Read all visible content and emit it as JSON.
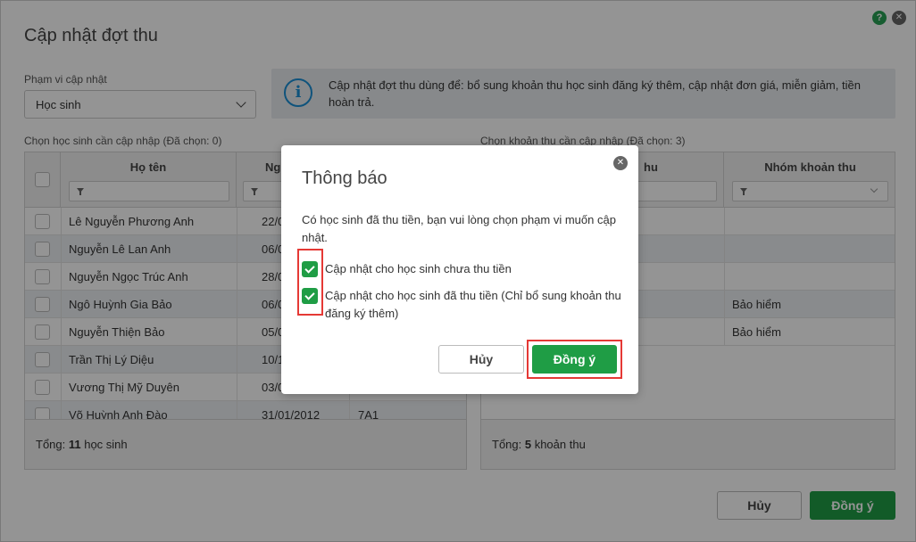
{
  "window": {
    "title": "Cập nhật đợt thu"
  },
  "scope": {
    "label": "Phạm vi cập nhật",
    "value": "Học sinh"
  },
  "info": {
    "text": "Cập nhật đợt thu dùng để: bổ sung khoản thu học sinh đăng ký thêm, cập nhật đơn giá, miễn giảm, tiền hoàn trả."
  },
  "students_grid": {
    "label": "Chọn học sinh cần cập nhập (Đã chọn: 0)",
    "columns": [
      "Họ tên",
      "Ng"
    ],
    "rows": [
      {
        "name": "Lê Nguyễn Phương Anh",
        "date": "22/0",
        "class": ""
      },
      {
        "name": "Nguyễn Lê  Lan Anh",
        "date": "06/0",
        "class": ""
      },
      {
        "name": "Nguyễn Ngọc Trúc Anh",
        "date": "28/0",
        "class": ""
      },
      {
        "name": "Ngô Huỳnh Gia Bảo",
        "date": "06/0",
        "class": ""
      },
      {
        "name": "Nguyễn Thiện Bảo",
        "date": "05/0",
        "class": ""
      },
      {
        "name": "Trần Thị Lý Diệu",
        "date": "10/1",
        "class": ""
      },
      {
        "name": "Vương Thị Mỹ Duyên",
        "date": "03/0",
        "class": ""
      },
      {
        "name": "Võ Huỳnh Anh Đào",
        "date": "31/01/2012",
        "class": "7A1"
      }
    ],
    "footer_prefix": "Tổng: ",
    "footer_count": "11",
    "footer_suffix": " học sinh"
  },
  "fees_grid": {
    "label": "Chọn khoản thu cần cập nhập (Đã chọn: 3)",
    "columns": [
      "hu",
      "Nhóm khoản thu"
    ],
    "rows": [
      {
        "group": ""
      },
      {
        "group": ""
      },
      {
        "group": ""
      },
      {
        "group": "Bảo hiểm"
      },
      {
        "group": "Bảo hiểm"
      }
    ],
    "footer_prefix": "Tổng: ",
    "footer_count": "5",
    "footer_suffix": " khoản thu"
  },
  "buttons": {
    "cancel": "Hủy",
    "ok": "Đồng ý"
  },
  "dialog": {
    "title": "Thông báo",
    "message": "Có học sinh đã thu tiền, bạn vui lòng chọn phạm vi muốn cập nhật.",
    "option1": "Cập nhật cho học sinh chưa thu tiền",
    "option2": "Cập nhật cho học sinh đã thu tiền (Chỉ bổ sung khoản thu đăng ký thêm)",
    "cancel": "Hủy",
    "ok": "Đồng ý"
  },
  "icons": {
    "help": "help-icon",
    "close": "close-icon",
    "info": "info-icon",
    "filter": "funnel-icon",
    "check": "check-icon"
  },
  "colors": {
    "accent": "#1f9d45",
    "highlight": "#e53935",
    "info": "#1a8fd6"
  }
}
